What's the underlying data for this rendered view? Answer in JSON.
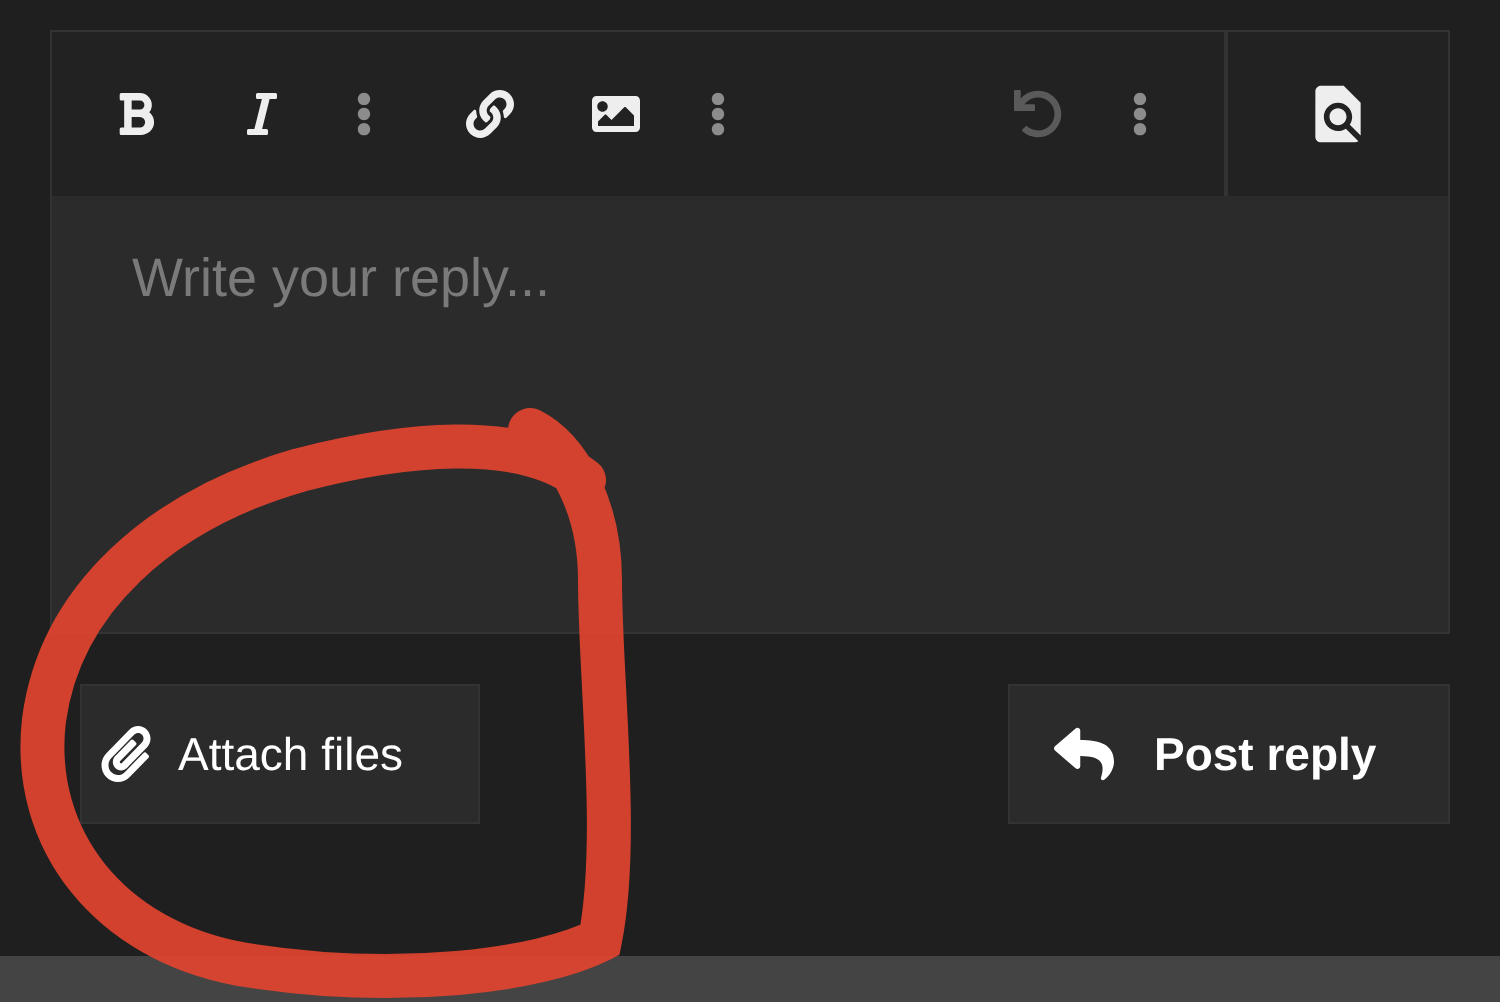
{
  "toolbar": {
    "left_buttons": [
      {
        "kind": "bold",
        "disabled": false
      },
      {
        "kind": "italic",
        "disabled": false
      },
      {
        "kind": "more",
        "disabled": false
      },
      {
        "kind": "link",
        "disabled": false
      },
      {
        "kind": "image",
        "disabled": false
      },
      {
        "kind": "more",
        "disabled": false
      }
    ],
    "right_buttons": [
      {
        "kind": "undo",
        "disabled": true
      },
      {
        "kind": "more",
        "disabled": false
      }
    ],
    "preview": {
      "kind": "preview"
    }
  },
  "editor": {
    "placeholder": "Write your reply..."
  },
  "attach_button": {
    "label": "Attach files"
  },
  "submit_button": {
    "label": "Post reply"
  }
}
